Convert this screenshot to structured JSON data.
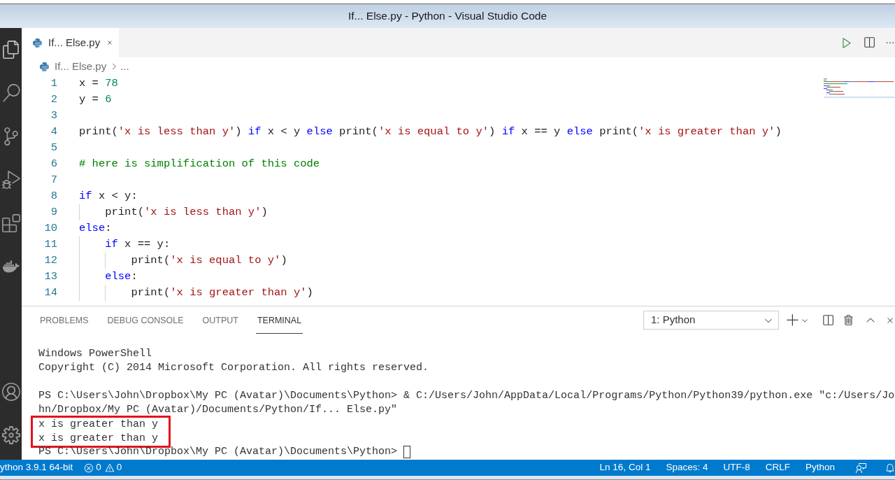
{
  "window": {
    "title": "If... Else.py - Python - Visual Studio Code"
  },
  "editor_tabs": [
    {
      "label": "If... Else.py",
      "selected": true
    }
  ],
  "breadcrumb": {
    "file": "If... Else.py",
    "symbol": "..."
  },
  "code_lines": [
    {
      "number": "1",
      "tokens": [
        {
          "kind": "plain",
          "text": "x = "
        },
        {
          "kind": "number",
          "text": "78"
        }
      ]
    },
    {
      "number": "2",
      "tokens": [
        {
          "kind": "plain",
          "text": "y = "
        },
        {
          "kind": "number",
          "text": "6"
        }
      ]
    },
    {
      "number": "3"
    },
    {
      "number": "4",
      "tokens": [
        {
          "kind": "plain",
          "text": "print("
        },
        {
          "kind": "string",
          "text": "'x is less than y'"
        },
        {
          "kind": "plain",
          "text": ") "
        },
        {
          "kind": "keyword",
          "text": "if"
        },
        {
          "kind": "plain",
          "text": " x < y "
        },
        {
          "kind": "keyword",
          "text": "else"
        },
        {
          "kind": "plain",
          "text": " print("
        },
        {
          "kind": "string",
          "text": "'x is equal to y'"
        },
        {
          "kind": "plain",
          "text": ") "
        },
        {
          "kind": "keyword",
          "text": "if"
        },
        {
          "kind": "plain",
          "text": " x == y "
        },
        {
          "kind": "keyword",
          "text": "else"
        },
        {
          "kind": "plain",
          "text": " print("
        },
        {
          "kind": "string",
          "text": "'x is greater than y'"
        },
        {
          "kind": "plain",
          "text": ")"
        }
      ]
    },
    {
      "number": "5"
    },
    {
      "number": "6",
      "tokens": [
        {
          "kind": "comment",
          "text": "# here is simplification of this code"
        }
      ]
    },
    {
      "number": "7"
    },
    {
      "number": "8",
      "tokens": [
        {
          "kind": "keyword",
          "text": "if"
        },
        {
          "kind": "plain",
          "text": " x < y:"
        }
      ]
    },
    {
      "number": "9",
      "tokens": [
        {
          "kind": "plain",
          "text": "    print("
        },
        {
          "kind": "string",
          "text": "'x is less than y'"
        },
        {
          "kind": "plain",
          "text": ")"
        }
      ]
    },
    {
      "number": "10",
      "tokens": [
        {
          "kind": "keyword",
          "text": "else"
        },
        {
          "kind": "plain",
          "text": ":"
        }
      ]
    },
    {
      "number": "11",
      "tokens": [
        {
          "kind": "keyword",
          "text": "    if"
        },
        {
          "kind": "plain",
          "text": " x == y:"
        }
      ]
    },
    {
      "number": "12",
      "tokens": [
        {
          "kind": "plain",
          "text": "        print("
        },
        {
          "kind": "string",
          "text": "'x is equal to y'"
        },
        {
          "kind": "plain",
          "text": ")"
        }
      ]
    },
    {
      "number": "13",
      "tokens": [
        {
          "kind": "keyword",
          "text": "    else"
        },
        {
          "kind": "plain",
          "text": ":"
        }
      ]
    },
    {
      "number": "14",
      "tokens": [
        {
          "kind": "plain",
          "text": "        print("
        },
        {
          "kind": "string",
          "text": "'x is greater than y'"
        },
        {
          "kind": "plain",
          "text": ")"
        }
      ]
    }
  ],
  "panel": {
    "tabs": [
      {
        "label": "PROBLEMS",
        "selected": false
      },
      {
        "label": "DEBUG CONSOLE",
        "selected": false
      },
      {
        "label": "OUTPUT",
        "selected": false
      },
      {
        "label": "TERMINAL",
        "selected": true
      }
    ],
    "terminal_select": "1: Python",
    "terminal": {
      "header": [
        "Windows PowerShell",
        "Copyright (C) 2014 Microsoft Corporation. All rights reserved."
      ],
      "command": [
        "PS C:\\Users\\John\\Dropbox\\My PC (Avatar)\\Documents\\Python> & C:/Users/John/AppData/Local/Programs/Python/Python39/python.exe \"c:/Users/Jo",
        "hn/Dropbox/My PC (Avatar)/Documents/Python/If... Else.py\""
      ],
      "highlighted_output": [
        "x is greater than y",
        "x is greater than y"
      ],
      "prompt": "PS C:\\Users\\John\\Dropbox\\My PC (Avatar)\\Documents\\Python>"
    }
  },
  "status_bar": {
    "interpreter": "ython 3.9.1 64-bit",
    "errors": "0",
    "warnings": "0",
    "position": "Ln 16, Col 1",
    "indentation": "Spaces: 4",
    "encoding": "UTF-8",
    "line_ending": "CRLF",
    "language": "Python"
  }
}
